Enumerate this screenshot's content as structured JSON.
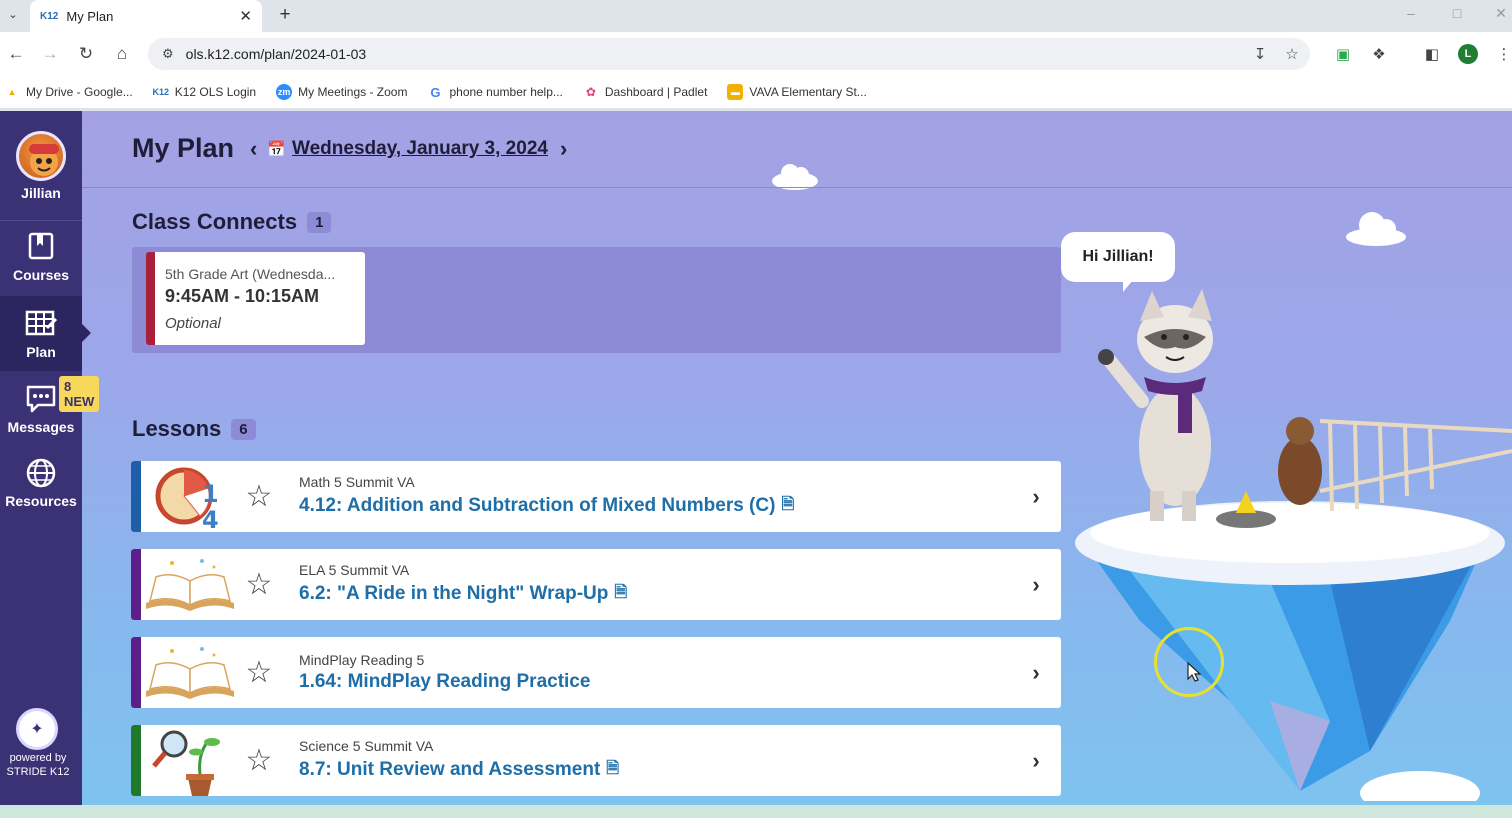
{
  "browser": {
    "tab_title": "My Plan",
    "tab_favicon": "K12",
    "url": "ols.k12.com/plan/2024-01-03",
    "profile_initial": "L",
    "bookmarks": [
      {
        "label": "My Drive - Google...",
        "icon": "drive-icon"
      },
      {
        "label": "K12 OLS Login",
        "icon": "k12-icon"
      },
      {
        "label": "My Meetings - Zoom",
        "icon": "zoom-icon"
      },
      {
        "label": "phone number help...",
        "icon": "google-icon"
      },
      {
        "label": "Dashboard | Padlet",
        "icon": "padlet-icon"
      },
      {
        "label": "VAVA Elementary St...",
        "icon": "folder-icon"
      }
    ]
  },
  "sidebar": {
    "user_name": "Jillian",
    "courses_label": "Courses",
    "plan_label": "Plan",
    "messages_label": "Messages",
    "messages_badge": "8 NEW",
    "resources_label": "Resources",
    "powered_by": "powered by",
    "stride": "STRIDE K12"
  },
  "header": {
    "title": "My Plan",
    "date": "Wednesday, January 3, 2024"
  },
  "class_connects": {
    "title": "Class Connects",
    "count": "1",
    "items": [
      {
        "course": "5th Grade Art (Wednesda...",
        "time": "9:45AM - 10:15AM",
        "note": "Optional",
        "color": "#a8203c"
      }
    ]
  },
  "lessons": {
    "title": "Lessons",
    "count": "6",
    "items": [
      {
        "course": "Math 5 Summit VA",
        "title": "4.12: Addition and Subtraction of Mixed Numbers (C)",
        "color": "#1e5fa8",
        "thumb": "pie-chart-icon",
        "has_doc": true
      },
      {
        "course": "ELA 5 Summit VA",
        "title": "6.2: \"A Ride in the Night\" Wrap-Up",
        "color": "#5b1e8a",
        "thumb": "open-book-icon",
        "has_doc": true
      },
      {
        "course": "MindPlay Reading 5",
        "title": "1.64: MindPlay Reading Practice",
        "color": "#5b1e8a",
        "thumb": "open-book-icon",
        "has_doc": false
      },
      {
        "course": "Science 5 Summit VA",
        "title": "8.7: Unit Review and Assessment",
        "color": "#1e7a2a",
        "thumb": "plant-magnifier-icon",
        "has_doc": true
      }
    ]
  },
  "mascot": {
    "greeting": "Hi Jillian!"
  }
}
